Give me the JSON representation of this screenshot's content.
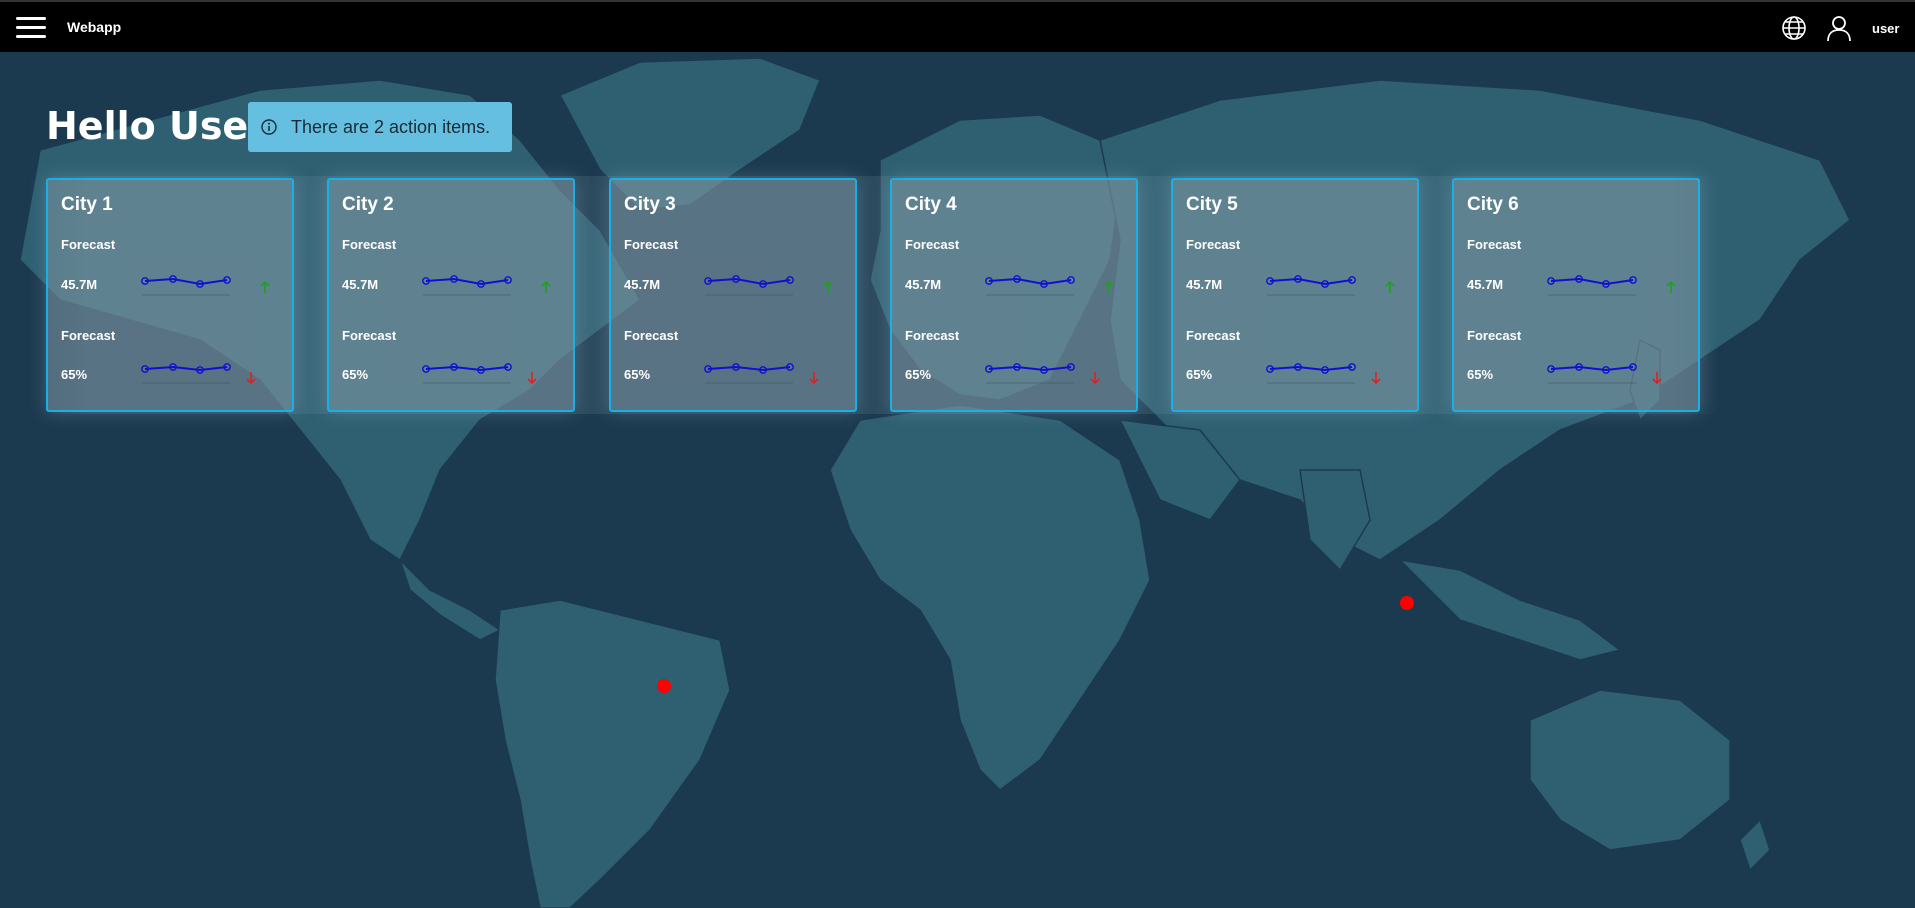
{
  "app": {
    "title": "Webapp",
    "user": "user"
  },
  "greeting": "Hello User,",
  "alert": {
    "text": "There are 2 action items."
  },
  "icons": [
    "menu-icon",
    "globe-icon",
    "user-icon",
    "info-icon",
    "arrow-up-icon",
    "arrow-down-icon"
  ],
  "colors": {
    "accent": "#19b0e8",
    "up": "#1aa31a",
    "down": "#e02020",
    "sparkline": "#1010d0",
    "pin": "#ff0000"
  },
  "cards": [
    {
      "city": "City 1",
      "metric1_label": "Forecast",
      "metric1_value": "45.7M",
      "metric1_trend": "up",
      "metric2_label": "Forecast",
      "metric2_value": "65%",
      "metric2_trend": "down"
    },
    {
      "city": "City 2",
      "metric1_label": "Forecast",
      "metric1_value": "45.7M",
      "metric1_trend": "up",
      "metric2_label": "Forecast",
      "metric2_value": "65%",
      "metric2_trend": "down"
    },
    {
      "city": "City 3",
      "metric1_label": "Forecast",
      "metric1_value": "45.7M",
      "metric1_trend": "up",
      "metric2_label": "Forecast",
      "metric2_value": "65%",
      "metric2_trend": "down"
    },
    {
      "city": "City 4",
      "metric1_label": "Forecast",
      "metric1_value": "45.7M",
      "metric1_trend": "up",
      "metric2_label": "Forecast",
      "metric2_value": "65%",
      "metric2_trend": "down"
    },
    {
      "city": "City 5",
      "metric1_label": "Forecast",
      "metric1_value": "45.7M",
      "metric1_trend": "up",
      "metric2_label": "Forecast",
      "metric2_value": "65%",
      "metric2_trend": "down"
    },
    {
      "city": "City 6",
      "metric1_label": "Forecast",
      "metric1_value": "45.7M",
      "metric1_trend": "up",
      "metric2_label": "Forecast",
      "metric2_value": "65%",
      "metric2_trend": "down"
    }
  ]
}
